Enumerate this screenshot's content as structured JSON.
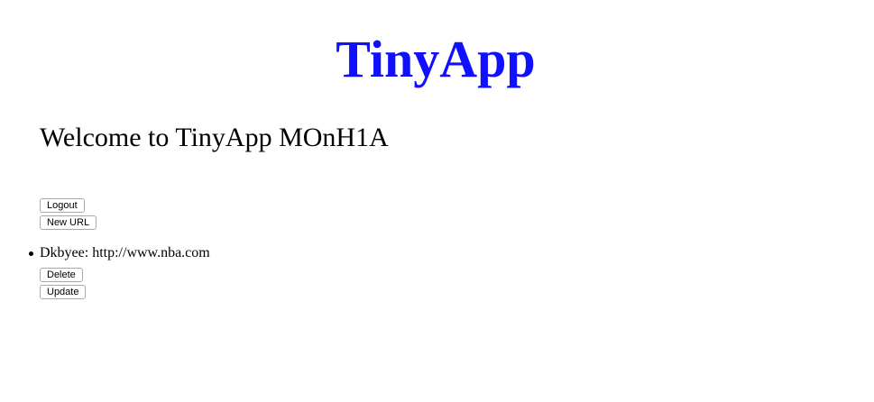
{
  "header": {
    "title": "TinyApp"
  },
  "welcome": {
    "text": "Welcome to TinyApp MOnH1A"
  },
  "actions": {
    "logout_label": "Logout",
    "new_url_label": "New URL"
  },
  "urls": [
    {
      "short": "Dkbyee",
      "separator": ": ",
      "long": "http://www.nba.com",
      "delete_label": "Delete",
      "update_label": "Update"
    }
  ],
  "colors": {
    "title": "#1010ff"
  }
}
